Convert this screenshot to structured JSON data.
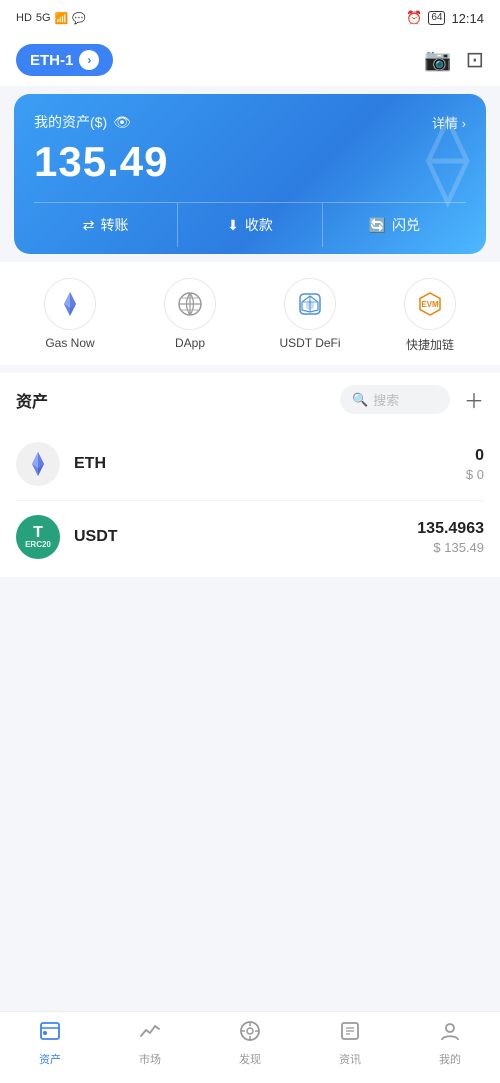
{
  "statusBar": {
    "leftText": "HD 5G",
    "battery": "64",
    "time": "12:14"
  },
  "header": {
    "walletLabel": "ETH-1",
    "scanLabel": "scan",
    "cameraLabel": "camera"
  },
  "assetCard": {
    "titleLabel": "我的资产($)",
    "detailLabel": "详情 ›",
    "amount": "135.49",
    "transferLabel": "转账",
    "receiveLabel": "收款",
    "exchangeLabel": "闪兑"
  },
  "quickAccess": [
    {
      "id": "gas-now",
      "label": "Gas Now",
      "icon": "⟠"
    },
    {
      "id": "dapp",
      "label": "DApp",
      "icon": "🧭"
    },
    {
      "id": "usdt-defi",
      "label": "USDT DeFi",
      "icon": "◈"
    },
    {
      "id": "evm-chain",
      "label": "快捷加链",
      "icon": "EVM"
    }
  ],
  "assetsSection": {
    "title": "资产",
    "searchPlaceholder": "搜索"
  },
  "assets": [
    {
      "id": "eth",
      "name": "ETH",
      "amount": "0",
      "usdValue": "$ 0"
    },
    {
      "id": "usdt",
      "name": "USDT",
      "amount": "135.4963",
      "usdValue": "$ 135.49"
    }
  ],
  "bottomNav": [
    {
      "id": "assets",
      "label": "资产",
      "active": true
    },
    {
      "id": "market",
      "label": "市场",
      "active": false
    },
    {
      "id": "discover",
      "label": "发现",
      "active": false
    },
    {
      "id": "news",
      "label": "资讯",
      "active": false
    },
    {
      "id": "profile",
      "label": "我的",
      "active": false
    }
  ]
}
